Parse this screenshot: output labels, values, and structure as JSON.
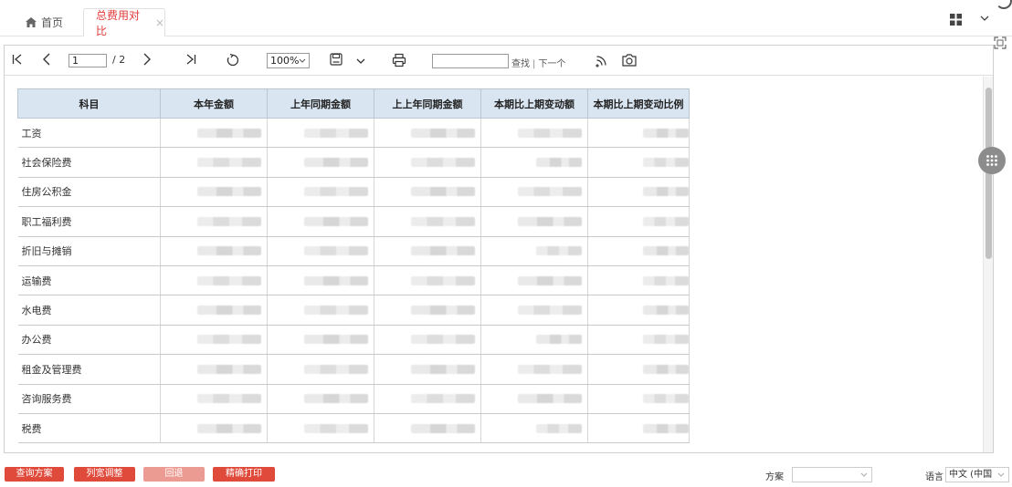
{
  "tabs": {
    "home_label": "首页",
    "active_label": "总费用对比",
    "close_glyph": "×"
  },
  "toolbar": {
    "page_value": "1",
    "page_total": "/ 2",
    "zoom": "100%",
    "search_label": "查找",
    "next_label": "下一个",
    "separator": "|"
  },
  "report": {
    "headers": [
      "科目",
      "本年金额",
      "上年同期金额",
      "上上年同期金额",
      "本期比上期变动额",
      "本期比上期变动比例"
    ],
    "rows": [
      "工资",
      "社会保险费",
      "住房公积金",
      "职工福利费",
      "折旧与摊销",
      "运输费",
      "水电费",
      "办公费",
      "租金及管理费",
      "咨询服务费",
      "税费"
    ]
  },
  "bottom": {
    "btn_query": "查询方案",
    "btn_col": "列宽调整",
    "btn_back": "回退",
    "btn_print": "精确打印",
    "scheme_label": "方案",
    "scheme_value": "",
    "lang_label": "语言",
    "lang_value": "中文 (中国"
  },
  "colors": {
    "accent": "#e03a3a",
    "button_red": "#e04a3b",
    "header_bg": "#d9e5f1"
  }
}
